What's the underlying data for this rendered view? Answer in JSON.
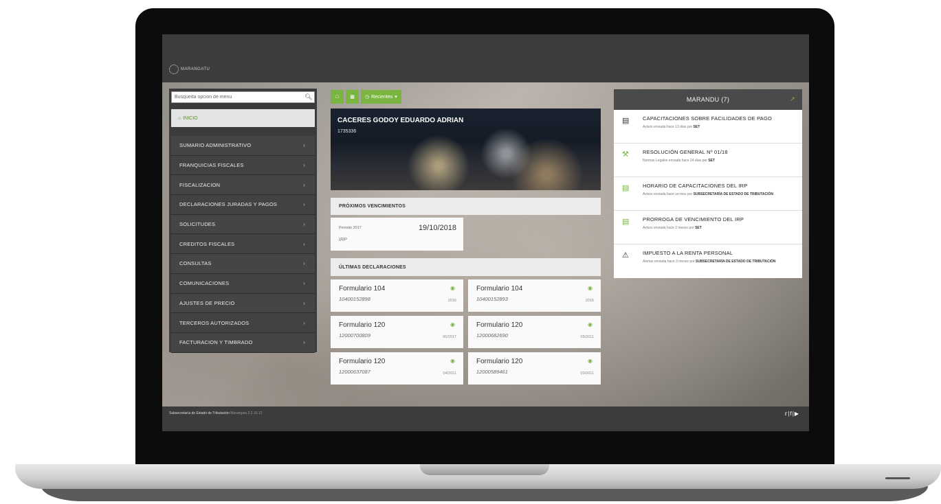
{
  "app": {
    "logo_text": "MARANGATU"
  },
  "sidebar": {
    "search_placeholder": "Busqueda opcion de menu",
    "inicio_label": "INICIO",
    "items": [
      {
        "label": "SUMARIO ADMINISTRATIVO"
      },
      {
        "label": "FRANQUICIAS FISCALES"
      },
      {
        "label": "FISCALIZACION"
      },
      {
        "label": "DECLARACIONES JURADAS Y PAGOS"
      },
      {
        "label": "SOLICITUDES"
      },
      {
        "label": "CREDITOS FISCALES"
      },
      {
        "label": "CONSULTAS"
      },
      {
        "label": "COMUNICACIONES"
      },
      {
        "label": "AJUSTES DE PRECIO"
      },
      {
        "label": "TERCEROS AUTORIZADOS"
      },
      {
        "label": "FACTURACION Y TIMBRADO"
      }
    ]
  },
  "toolbar": {
    "recientes_label": "Recientes"
  },
  "profile": {
    "name": "CACERES GODOY EDUARDO ADRIAN",
    "ruc": "1735336"
  },
  "vencimientos": {
    "title": "PRÓXIMOS VENCIMIENTOS",
    "period_label": "Periodo 2017",
    "date": "19/10/2018",
    "tax": "IRP"
  },
  "declaraciones": {
    "title": "ÚLTIMAS DECLARACIONES",
    "items": [
      {
        "form": "Formulario 104",
        "number": "10400152898",
        "period": "2016"
      },
      {
        "form": "Formulario 104",
        "number": "10400152893",
        "period": "2015"
      },
      {
        "form": "Formulario 120",
        "number": "12000700809",
        "period": "06/2017"
      },
      {
        "form": "Formulario 120",
        "number": "12000682690",
        "period": "05/2011"
      },
      {
        "form": "Formulario 120",
        "number": "12000637087",
        "period": "04/2011"
      },
      {
        "form": "Formulario 120",
        "number": "12000589461",
        "period": "03/2011"
      }
    ]
  },
  "marandu": {
    "title": "MARANDU (7)",
    "items": [
      {
        "icon": "newspaper-icon",
        "title": "CAPACITACIONES SOBRE FACILIDADES DE PAGO",
        "sub": "Avisos enviada hace 13 días por ",
        "sender": "SET"
      },
      {
        "icon": "gavel-icon",
        "title": "RESOLUCIÓN GENERAL Nº 01/18",
        "sub": "Normas Legales enviada hace 24 días por ",
        "sender": "SET"
      },
      {
        "icon": "newspaper-icon",
        "title": "HORARIO DE CAPACITACIONES DEL IRP",
        "sub": "Avisos enviada hace un mes por ",
        "sender": "SUBSECRETARÍA DE ESTADO DE TRIBUTACIÓN"
      },
      {
        "icon": "newspaper-icon",
        "title": "PRORROGA DE VENCIMIENTO DEL IRP",
        "sub": "Avisos enviada hace 2 meses por ",
        "sender": "SET"
      },
      {
        "icon": "warning-icon",
        "title": "IMPUESTO A LA RENTA PERSONAL",
        "sub": "Alertas enviada hace 3 meses por ",
        "sender": "SUBSECRETARÍA DE ESTADO DE TRIBUTACIÓN"
      }
    ]
  },
  "footer": {
    "org": "Subsecretaría de Estado de Tributación",
    "version": "Marangatu 2.2.16.12",
    "social": "twitter facebook youtube"
  },
  "colors": {
    "accent": "#79b53f",
    "bar": "#3a3c3e",
    "sidebar": "#3b3b3b"
  }
}
